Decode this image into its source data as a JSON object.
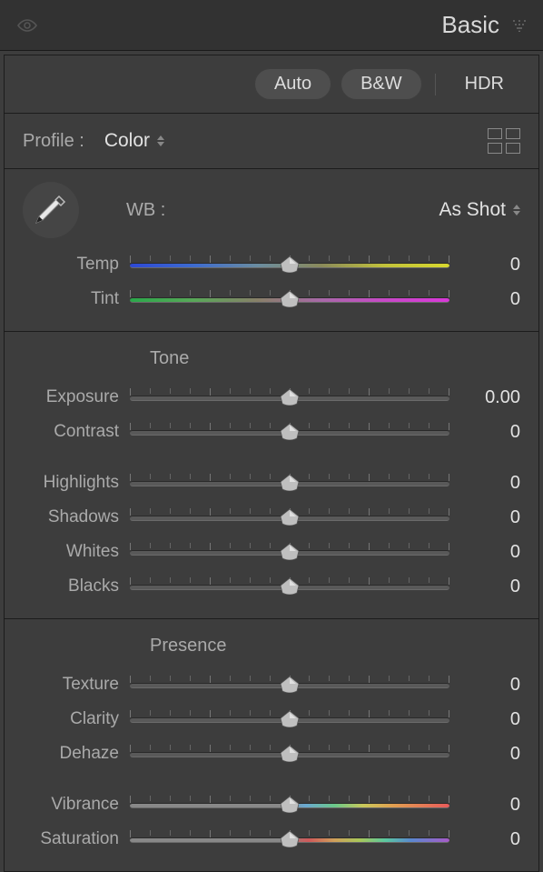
{
  "panel": {
    "title": "Basic"
  },
  "topbar": {
    "auto": "Auto",
    "bw": "B&W",
    "hdr": "HDR"
  },
  "profile": {
    "label": "Profile :",
    "value": "Color"
  },
  "wb": {
    "label": "WB :",
    "value": "As Shot",
    "sliders": [
      {
        "label": "Temp",
        "value": "0",
        "track": "temp"
      },
      {
        "label": "Tint",
        "value": "0",
        "track": "tint"
      }
    ]
  },
  "tone": {
    "title": "Tone",
    "group1": [
      {
        "label": "Exposure",
        "value": "0.00"
      },
      {
        "label": "Contrast",
        "value": "0"
      }
    ],
    "group2": [
      {
        "label": "Highlights",
        "value": "0"
      },
      {
        "label": "Shadows",
        "value": "0"
      },
      {
        "label": "Whites",
        "value": "0"
      },
      {
        "label": "Blacks",
        "value": "0"
      }
    ]
  },
  "presence": {
    "title": "Presence",
    "group1": [
      {
        "label": "Texture",
        "value": "0"
      },
      {
        "label": "Clarity",
        "value": "0"
      },
      {
        "label": "Dehaze",
        "value": "0"
      }
    ],
    "group2": [
      {
        "label": "Vibrance",
        "value": "0",
        "track": "vibrance"
      },
      {
        "label": "Saturation",
        "value": "0",
        "track": "saturation"
      }
    ]
  }
}
